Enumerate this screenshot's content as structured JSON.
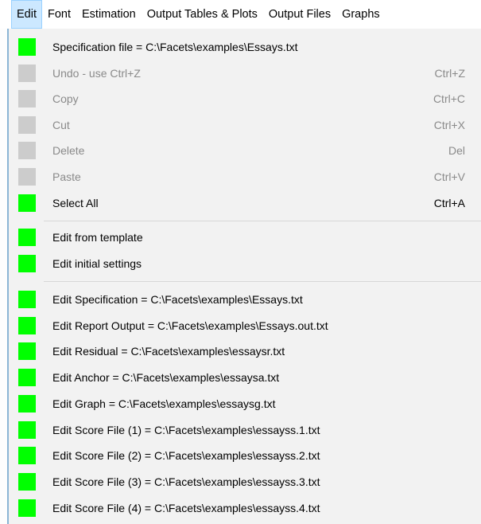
{
  "menubar": {
    "items": [
      "Edit",
      "Font",
      "Estimation",
      "Output Tables & Plots",
      "Output Files",
      "Graphs"
    ]
  },
  "menu": {
    "items": [
      {
        "label": "Specification file = C:\\Facets\\examples\\Essays.txt",
        "shortcut": "",
        "enabled": true
      },
      {
        "label": "Undo - use Ctrl+Z",
        "shortcut": "Ctrl+Z",
        "enabled": false
      },
      {
        "label": "Copy",
        "shortcut": "Ctrl+C",
        "enabled": false
      },
      {
        "label": "Cut",
        "shortcut": "Ctrl+X",
        "enabled": false
      },
      {
        "label": "Delete",
        "shortcut": "Del",
        "enabled": false
      },
      {
        "label": "Paste",
        "shortcut": "Ctrl+V",
        "enabled": false
      },
      {
        "label": "Select All",
        "shortcut": "Ctrl+A",
        "enabled": true
      },
      {
        "label": "Edit from template",
        "shortcut": "",
        "enabled": true
      },
      {
        "label": "Edit initial settings",
        "shortcut": "",
        "enabled": true
      },
      {
        "label": "Edit Specification = C:\\Facets\\examples\\Essays.txt",
        "shortcut": "",
        "enabled": true
      },
      {
        "label": "Edit Report Output = C:\\Facets\\examples\\Essays.out.txt",
        "shortcut": "",
        "enabled": true
      },
      {
        "label": "Edit Residual = C:\\Facets\\examples\\essaysr.txt",
        "shortcut": "",
        "enabled": true
      },
      {
        "label": "Edit Anchor = C:\\Facets\\examples\\essaysa.txt",
        "shortcut": "",
        "enabled": true
      },
      {
        "label": "Edit Graph = C:\\Facets\\examples\\essaysg.txt",
        "shortcut": "",
        "enabled": true
      },
      {
        "label": "Edit Score File (1) = C:\\Facets\\examples\\essayss.1.txt",
        "shortcut": "",
        "enabled": true
      },
      {
        "label": "Edit Score File (2) = C:\\Facets\\examples\\essayss.2.txt",
        "shortcut": "",
        "enabled": true
      },
      {
        "label": "Edit Score File (3) = C:\\Facets\\examples\\essayss.3.txt",
        "shortcut": "",
        "enabled": true
      },
      {
        "label": "Edit Score File (4) = C:\\Facets\\examples\\essayss.4.txt",
        "shortcut": "",
        "enabled": true
      }
    ]
  },
  "colors": {
    "enabled_square": "#00ff00",
    "disabled_square": "#cccccc",
    "active_menu_bg": "#cce8ff"
  }
}
